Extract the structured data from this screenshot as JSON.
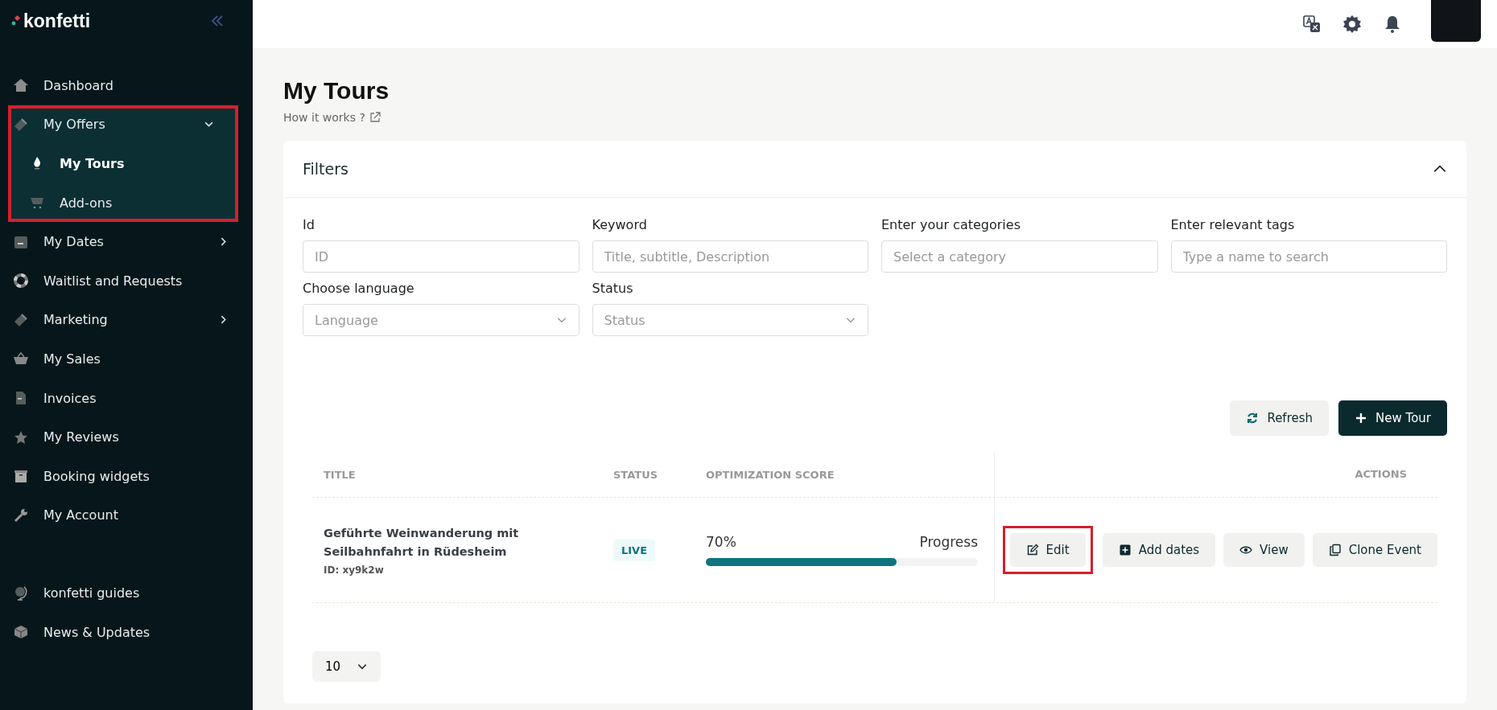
{
  "sidebar": {
    "logo": "konfetti",
    "items": [
      {
        "label": "Dashboard",
        "selected": false
      },
      {
        "label": "My Offers",
        "selected": false,
        "expanded": true,
        "annotated": true,
        "children": [
          {
            "label": "My Tours",
            "selected": true
          },
          {
            "label": "Add-ons",
            "selected": false
          }
        ]
      },
      {
        "label": "My Dates",
        "selected": false,
        "expanded": false
      },
      {
        "label": "Waitlist and Requests",
        "selected": false
      },
      {
        "label": "Marketing",
        "selected": false,
        "expanded": false
      },
      {
        "label": "My Sales",
        "selected": false
      },
      {
        "label": "Invoices",
        "selected": false
      },
      {
        "label": "My Reviews",
        "selected": false
      },
      {
        "label": "Booking widgets",
        "selected": false
      },
      {
        "label": "My Account",
        "selected": false
      }
    ],
    "footer_items": [
      {
        "label": "konfetti guides",
        "selected": false
      },
      {
        "label": "News & Updates",
        "selected": false
      }
    ]
  },
  "page": {
    "title": "My Tours",
    "help_link": "How it works ?"
  },
  "filters": {
    "title": "Filters",
    "expanded": true,
    "fields": [
      {
        "kind": "text",
        "label": "Id",
        "placeholder": "ID"
      },
      {
        "kind": "text",
        "label": "Keyword",
        "placeholder": "Title, subtitle, Description"
      },
      {
        "kind": "text",
        "label": "Enter your categories",
        "placeholder": "Select a category"
      },
      {
        "kind": "text",
        "label": "Enter relevant tags",
        "placeholder": "Type a name to search"
      },
      {
        "kind": "select",
        "label": "Choose language",
        "placeholder": "Language"
      },
      {
        "kind": "select",
        "label": "Status",
        "placeholder": "Status"
      }
    ]
  },
  "toolbar": [
    {
      "kind": "secondary",
      "label": "Refresh"
    },
    {
      "kind": "primary",
      "label": "New Tour"
    }
  ],
  "table": {
    "columns": [
      "TITLE",
      "STATUS",
      "OPTIMIZATION SCORE",
      "ACTIONS"
    ],
    "rows": [
      {
        "title": "Geführte Weinwanderung mit Seilbahnfahrt in Rüdesheim",
        "id": "ID: xy9k2w",
        "status": "LIVE",
        "score": "70%",
        "progress_label": "Progress",
        "level": 0.7,
        "actions": [
          {
            "kind": "edit",
            "label": "Edit",
            "annotated": true
          },
          {
            "kind": "add",
            "label": "Add dates",
            "annotated": false
          },
          {
            "kind": "view",
            "label": "View",
            "annotated": false
          },
          {
            "kind": "clone",
            "label": "Clone Event",
            "annotated": false
          }
        ]
      }
    ]
  },
  "page_size": "10"
}
